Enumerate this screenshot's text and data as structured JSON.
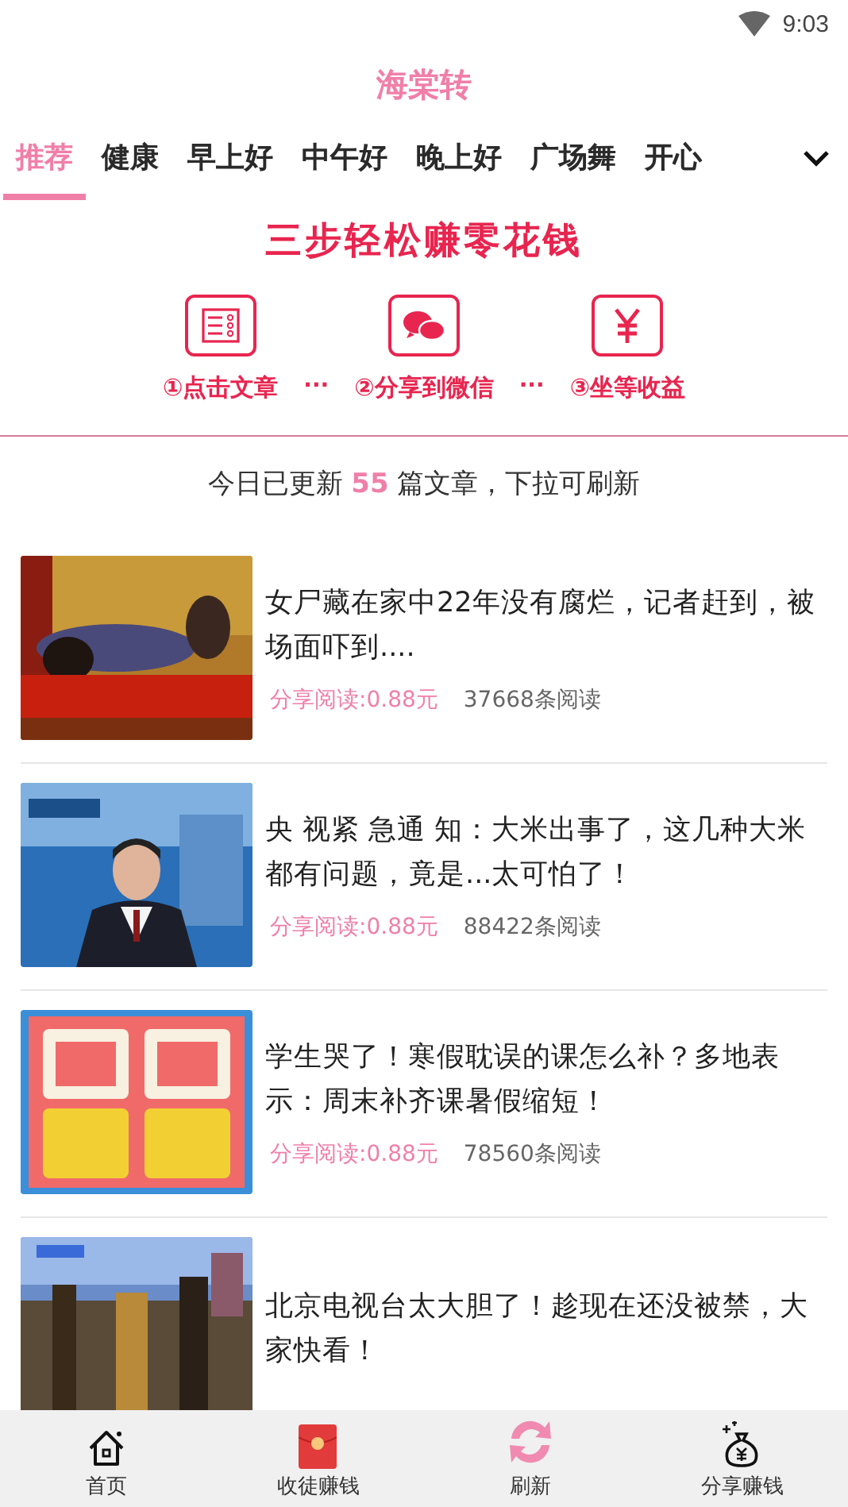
{
  "status_bar": {
    "time": "9:03"
  },
  "app_title": "海棠转",
  "tabs": [
    {
      "label": "推荐",
      "selected": true
    },
    {
      "label": "健康",
      "selected": false
    },
    {
      "label": "早上好",
      "selected": false
    },
    {
      "label": "中午好",
      "selected": false
    },
    {
      "label": "晚上好",
      "selected": false
    },
    {
      "label": "广场舞",
      "selected": false
    },
    {
      "label": "开心",
      "selected": false
    }
  ],
  "banner": {
    "title": "三步轻松赚零花钱",
    "separator": "···",
    "steps": [
      {
        "number": "①",
        "label": "点击文章"
      },
      {
        "number": "②",
        "label": "分享到微信"
      },
      {
        "number": "③",
        "label": "坐等收益"
      }
    ]
  },
  "update_notice": "今日已更新 **55** 篇文章，下拉可刷新",
  "articles": [
    {
      "title": "女尸藏在家中22年没有腐烂，记者赶到，被场面吓到....",
      "reward": "分享阅读:0.88元",
      "reads": "37668条阅读"
    },
    {
      "title": "央 视紧 急通 知：大米出事了，这几种大米都有问题，竟是...太可怕了！",
      "reward": "分享阅读:0.88元",
      "reads": "88422条阅读"
    },
    {
      "title": "学生哭了！寒假耽误的课怎么补？多地表示：周末补齐课暑假缩短！",
      "reward": "分享阅读:0.88元",
      "reads": "78560条阅读"
    },
    {
      "title": "北京电视台太大胆了！趁现在还没被禁，大家快看！"
    }
  ],
  "bottom_nav": [
    {
      "label": "首页"
    },
    {
      "label": "收徒赚钱"
    },
    {
      "label": "刷新"
    },
    {
      "label": "分享赚钱"
    }
  ]
}
